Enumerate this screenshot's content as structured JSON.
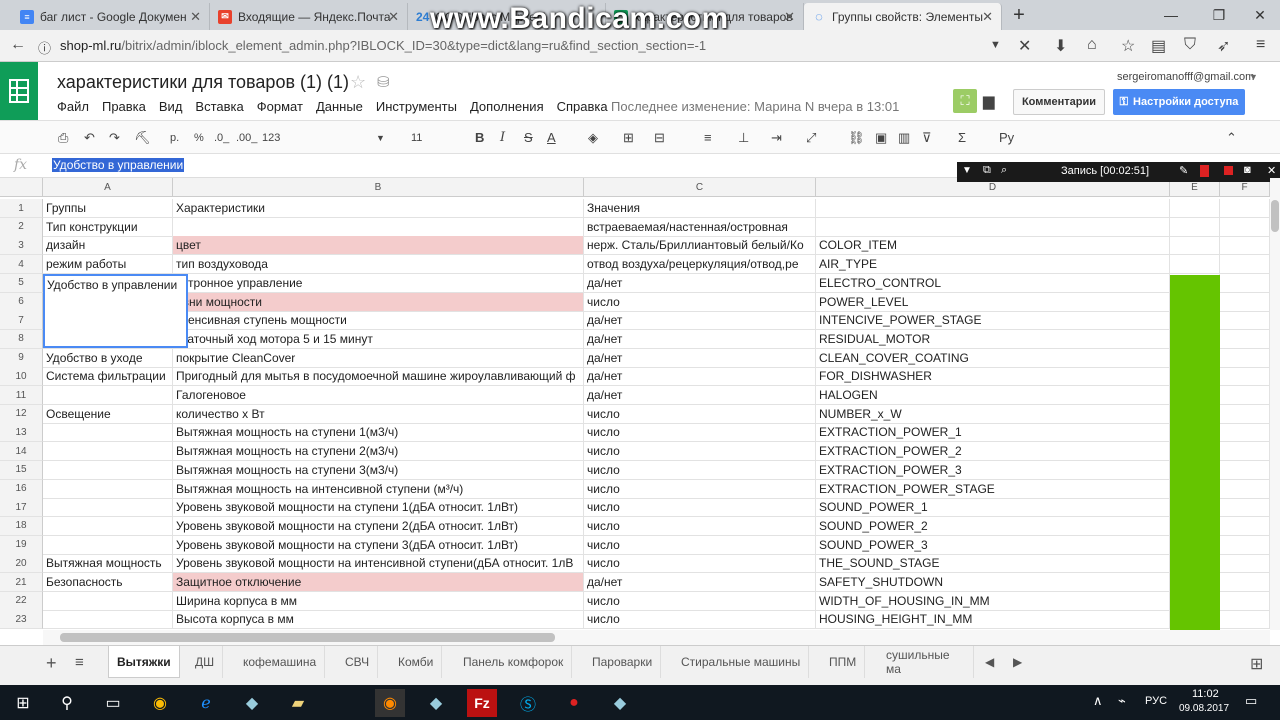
{
  "browser": {
    "tabs": [
      {
        "label": "баг лист - Google Докумен",
        "fav": "docs-icon",
        "color": "#4285f4"
      },
      {
        "label": "Входящие — Яндекс.Почта",
        "fav": "mail-icon",
        "color": "#e8412c"
      },
      {
        "label": "ООО \"Бакс Маркет\"",
        "fav": "24",
        "color": "#2d7dd2"
      },
      {
        "label": "характеристики для товаров",
        "fav": "sheets-icon",
        "color": "#0f9d58"
      },
      {
        "label": "Группы свойств: Элементы",
        "fav": "loading-icon",
        "color": "#1a73e8"
      }
    ],
    "url_host": "shop-ml.ru",
    "url_path": "/bitrix/admin/iblock_element_admin.php?IBLOCK_ID=30&type=dict&lang=ru&find_section_section=-1",
    "watermark": "www.Bandicam.com"
  },
  "sheet": {
    "title": "характеристики для товаров (1) (1)",
    "menu": [
      "Файл",
      "Правка",
      "Вид",
      "Вставка",
      "Формат",
      "Данные",
      "Инструменты",
      "Дополнения",
      "Справка"
    ],
    "last_edit": "Последнее изменение: Марина N вчера в 13:01",
    "email": "sergeiromanofff@gmail.com",
    "comments_label": "Комментарии",
    "share_label": "Настройки доступа",
    "toolbar": {
      "currency": "р.",
      "percent": "%",
      "dec0": ".0_",
      "dec00": ".00_",
      "numfmt": "123",
      "fontsize": "11",
      "lang": "Ру"
    },
    "formula_label": "fx",
    "formula_value": "Удобство в управлении",
    "recorder": "Запись [00:02:51]",
    "columns": [
      "A",
      "B",
      "C",
      "D",
      "E",
      "F"
    ],
    "rows": [
      {
        "n": "1",
        "a": "Группы",
        "b": "Характеристики",
        "c": "Значения",
        "d": ""
      },
      {
        "n": "2",
        "a": "Тип конструкции",
        "b": "",
        "c": "встраеваемая/настенная/островная",
        "d": ""
      },
      {
        "n": "3",
        "a": "дизайн",
        "b": "цвет",
        "c": "нерж. Сталь/Бриллиантовый белый/Ко",
        "d": "COLOR_ITEM"
      },
      {
        "n": "4",
        "a": "режим работы",
        "b": "тип воздуховода",
        "c": "отвод воздуха/рецеркуляция/отвод,ре",
        "d": "AIR_TYPE"
      },
      {
        "n": "5",
        "a": "",
        "b": "ектронное управление",
        "c": "да/нет",
        "d": "ELECTRO_CONTROL"
      },
      {
        "n": "6",
        "a": "",
        "b": "овни мощности",
        "c": "число",
        "d": "POWER_LEVEL"
      },
      {
        "n": "7",
        "a": "",
        "b": "нтенсивная ступень мощности",
        "c": "да/нет",
        "d": "INTENCIVE_POWER_STAGE"
      },
      {
        "n": "8",
        "a": "",
        "b": "статочный ход мотора 5 и 15 минут",
        "c": "да/нет",
        "d": "RESIDUAL_MOTOR"
      },
      {
        "n": "9",
        "a": "Удобство в уходе",
        "b": "покрытие CleanCover",
        "c": "да/нет",
        "d": "CLEAN_COVER_COATING"
      },
      {
        "n": "10",
        "a": "Система фильтрации",
        "b": "Пригодный для мытья в посудомоечной машине жироулавливающий ф",
        "c": "да/нет",
        "d": "FOR_DISHWASHER"
      },
      {
        "n": "11",
        "a": "",
        "b": "Галогеновое",
        "c": "да/нет",
        "d": "HALOGEN"
      },
      {
        "n": "12",
        "a": "Освещение",
        "b": "количество х Вт",
        "c": "число",
        "d": "NUMBER_x_W"
      },
      {
        "n": "13",
        "a": "",
        "b": "Вытяжная мощность на ступени 1(м3/ч)",
        "c": "число",
        "d": "EXTRACTION_POWER_1"
      },
      {
        "n": "14",
        "a": "",
        "b": "Вытяжная мощность на ступени 2(м3/ч)",
        "c": "число",
        "d": "EXTRACTION_POWER_2"
      },
      {
        "n": "15",
        "a": "",
        "b": "Вытяжная мощность на ступени 3(м3/ч)",
        "c": "число",
        "d": "EXTRACTION_POWER_3"
      },
      {
        "n": "16",
        "a": "",
        "b": "Вытяжная мощность на интенсивной ступени (м³/ч)",
        "c": "число",
        "d": "EXTRACTION_POWER_STAGE"
      },
      {
        "n": "17",
        "a": "",
        "b": "Уровень звуковой мощности на ступени 1(дБА относит. 1лВт)",
        "c": "число",
        "d": "SOUND_POWER_1"
      },
      {
        "n": "18",
        "a": "",
        "b": "Уровень звуковой мощности на ступени 2(дБА относит. 1лВт)",
        "c": "число",
        "d": "SOUND_POWER_2"
      },
      {
        "n": "19",
        "a": "",
        "b": "Уровень звуковой мощности на ступени 3(дБА относит. 1лВт)",
        "c": "число",
        "d": "SOUND_POWER_3"
      },
      {
        "n": "20",
        "a": "Вытяжная мощность",
        "b": "Уровень звуковой мощности на интенсивной ступени(дБА относит. 1лВ",
        "c": "число",
        "d": "THE_SOUND_STAGE"
      },
      {
        "n": "21",
        "a": "Безопасность",
        "b": "Защитное отключение",
        "c": "да/нет",
        "d": "SAFETY_SHUTDOWN"
      },
      {
        "n": "22",
        "a": "",
        "b": "Ширина корпуса в мм",
        "c": "число",
        "d": "WIDTH_OF_HOUSING_IN_MM"
      },
      {
        "n": "23",
        "a": "",
        "b": "Высота корпуса в мм",
        "c": "число",
        "d": "HOUSING_HEIGHT_IN_MM"
      }
    ],
    "selected_cell": "Удобство в управлении",
    "sheet_tabs": [
      "Вытяжки",
      "ДШ",
      "кофемашина",
      "СВЧ",
      "Комби",
      "Панель комфорок",
      "Пароварки",
      "Стиральные машины",
      "ППМ",
      "сушильные ма"
    ]
  },
  "taskbar": {
    "lang": "РУС",
    "time": "11:02",
    "date": "09.08.2017"
  }
}
